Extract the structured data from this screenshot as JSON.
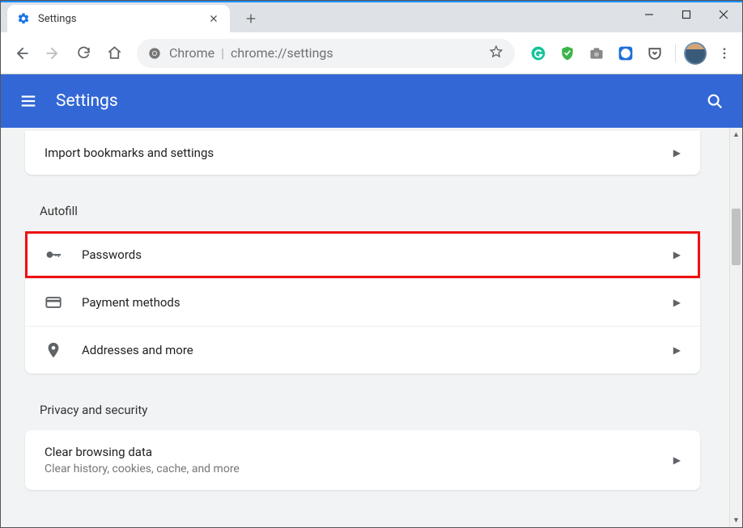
{
  "window": {
    "tab_title": "Settings"
  },
  "omnibox": {
    "label": "Chrome",
    "url": "chrome://settings"
  },
  "header": {
    "title": "Settings"
  },
  "import": {
    "label": "Import bookmarks and settings"
  },
  "sections": {
    "autofill": {
      "title": "Autofill",
      "items": [
        {
          "label": "Passwords"
        },
        {
          "label": "Payment methods"
        },
        {
          "label": "Addresses and more"
        }
      ]
    },
    "privacy": {
      "title": "Privacy and security",
      "items": [
        {
          "label": "Clear browsing data",
          "sub": "Clear history, cookies, cache, and more"
        }
      ]
    }
  }
}
